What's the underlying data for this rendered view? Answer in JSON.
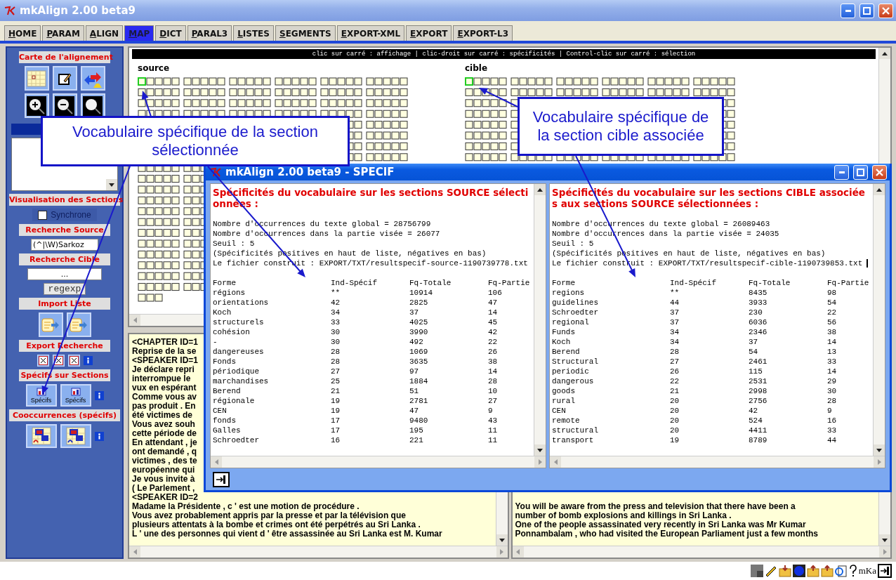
{
  "window": {
    "title": "mkAlign 2.00 beta9"
  },
  "tabs": [
    {
      "label": "HOME",
      "selected": false
    },
    {
      "label": "PARAM",
      "selected": false
    },
    {
      "label": "ALIGN",
      "selected": false
    },
    {
      "label": "MAP",
      "selected": true
    },
    {
      "label": "DICT",
      "selected": false
    },
    {
      "label": "PARAL3",
      "selected": false
    },
    {
      "label": "LISTES",
      "selected": false
    },
    {
      "label": "SEGMENTS",
      "selected": false
    },
    {
      "label": "EXPORT-XML",
      "selected": false
    },
    {
      "label": "EXPORT",
      "selected": false
    },
    {
      "label": "EXPORT-L3",
      "selected": false
    }
  ],
  "sidebar": {
    "map_title": "Carte de l'alignement",
    "view_title": "Visualisation des Sections",
    "synchrone": {
      "label": "Synchrone",
      "checked": false
    },
    "source_search": {
      "title": "Recherche Source",
      "value": "(^|\\W)Sarkoz"
    },
    "target_search": {
      "title": "Recherche Cible",
      "value": "...",
      "mode": "regexp"
    },
    "import_title": "Import Liste",
    "export_title": "Export Recherche",
    "specif_title": "Spécifs sur Sections",
    "specif_buttons": [
      "Spécifs",
      "Spécifs"
    ],
    "cooc_title": "Cooccurrences (spécifs)"
  },
  "map": {
    "hint": "clic sur carré : affichage | clic-droit sur carré : spécificités | Control-clic sur carré : sélection",
    "source": {
      "label": "source",
      "first_square_selected": true
    },
    "cible": {
      "label": "cible",
      "first_square_selected": true
    }
  },
  "text_panels": [
    {
      "lines": [
        "<CHAPTER ID=1",
        "Reprise de la se",
        "<SPEAKER ID=1",
        "Je déclare repri",
        "interrompue le",
        "vux en espérant",
        "Comme vous av",
        "pas produit . En",
        "été victimes de",
        "Vous avez souh",
        "cette période de",
        "En attendant , je",
        "ont demandé , q",
        "victimes , des te",
        "européenne qui",
        "Je vous invite à",
        "( Le Parlement ,",
        "<SPEAKER ID=2",
        "Madame la Présidente , c ' est une motion de procédure .",
        "Vous avez probablement appris par la presse et par la télévision que",
        "plusieurs attentats à la bombe et crimes ont été perpétrés au Sri Lanka .",
        "L ' une des personnes qui vient d ' être assassinée au Sri Lanka est M. Kumar"
      ]
    },
    {
      "lines": [
        "You will be aware from the press and television that there have been a",
        "number of bomb explosions and killings in Sri Lanka .",
        "One of the people assassinated very recently in Sri Lanka was Mr Kumar",
        "Ponnambalam , who had visited the European Parliament just a few months"
      ]
    }
  ],
  "specif_window": {
    "title": "mkAlign 2.00 beta9 - SPECIF",
    "panes": [
      {
        "heading": "Spécificités du vocabulaire sur les sections SOURCE sélectionnées :",
        "cursor": false,
        "info": [
          "Nombre d'occurrences du texte global = 28756799",
          "Nombre d'occurrences dans la partie visée = 26077",
          "Seuil : 5",
          "(Spécificités positives en haut de liste, négatives en bas)",
          "Le fichier construit : EXPORT/TXT/resultspecif-source-1190739778.txt"
        ],
        "columns": [
          "Forme",
          "Ind-Spécif",
          "Fq-Totale",
          "Fq-Partie"
        ],
        "rows": [
          [
            "régions",
            "**",
            "10914",
            "106"
          ],
          [
            "orientations",
            "42",
            "2825",
            "47"
          ],
          [
            "Koch",
            "34",
            "37",
            "14"
          ],
          [
            "structurels",
            "33",
            "4025",
            "45"
          ],
          [
            "cohésion",
            "30",
            "3990",
            "42"
          ],
          [
            "-",
            "30",
            "492",
            "22"
          ],
          [
            "dangereuses",
            "28",
            "1069",
            "26"
          ],
          [
            "Fonds",
            "28",
            "3635",
            "38"
          ],
          [
            "périodique",
            "27",
            "97",
            "14"
          ],
          [
            "marchandises",
            "25",
            "1884",
            "28"
          ],
          [
            "Berend",
            "21",
            "51",
            "10"
          ],
          [
            "régionale",
            "19",
            "2781",
            "27"
          ],
          [
            "CEN",
            "19",
            "47",
            "9"
          ],
          [
            "fonds",
            "17",
            "9480",
            "43"
          ],
          [
            "Galles",
            "17",
            "195",
            "11"
          ],
          [
            "Schroedter",
            "16",
            "221",
            "11"
          ]
        ]
      },
      {
        "heading": "Spécificités du vocabulaire sur les sections CIBLE associées aux sections SOURCE sélectionnées :",
        "cursor": true,
        "info": [
          "Nombre d'occurrences du texte global = 26089463",
          "Nombre d'occurrences dans la partie visée = 24035",
          "Seuil : 5",
          "(Spécificités positives en haut de liste, négatives en bas)",
          "Le fichier construit : EXPORT/TXT/resultspecif-cible-1190739853.txt"
        ],
        "columns": [
          "Forme",
          "Ind-Spécif",
          "Fq-Totale",
          "Fq-Partie"
        ],
        "rows": [
          [
            "regions",
            "**",
            "8435",
            "98"
          ],
          [
            "guidelines",
            "44",
            "3933",
            "54"
          ],
          [
            "Schroedter",
            "37",
            "230",
            "22"
          ],
          [
            "regional",
            "37",
            "6036",
            "56"
          ],
          [
            "Funds",
            "34",
            "2346",
            "38"
          ],
          [
            "Koch",
            "34",
            "37",
            "14"
          ],
          [
            "Berend",
            "28",
            "54",
            "13"
          ],
          [
            "Structural",
            "27",
            "2461",
            "33"
          ],
          [
            "periodic",
            "26",
            "115",
            "14"
          ],
          [
            "dangerous",
            "22",
            "2531",
            "29"
          ],
          [
            "goods",
            "21",
            "2998",
            "30"
          ],
          [
            "rural",
            "20",
            "2756",
            "28"
          ],
          [
            "CEN",
            "20",
            "42",
            "9"
          ],
          [
            "remote",
            "20",
            "524",
            "16"
          ],
          [
            "structural",
            "20",
            "4411",
            "33"
          ],
          [
            "transport",
            "19",
            "8789",
            "44"
          ]
        ]
      }
    ]
  },
  "callouts": [
    {
      "text": "Vocabulaire spécifique de la section sélectionnée"
    },
    {
      "text": "Vocabulaire spécifique de la section cible associée"
    }
  ],
  "status_bar": {
    "logo": "mKa"
  }
}
